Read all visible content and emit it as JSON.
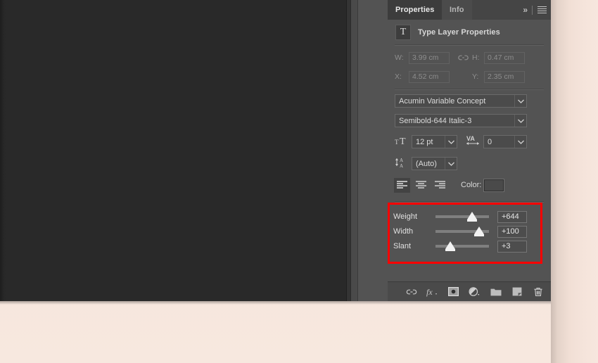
{
  "panel": {
    "tabs": [
      {
        "label": "Properties",
        "active": true
      },
      {
        "label": "Info",
        "active": false
      }
    ],
    "collapse_icon": "»",
    "menu_icon": "hamburger-menu-icon",
    "title": "Type Layer Properties",
    "title_icon_glyph": "T"
  },
  "geometry": {
    "w_label": "W:",
    "w_value": "3.99 cm",
    "h_label": "H:",
    "h_value": "0.47 cm",
    "x_label": "X:",
    "x_value": "4.52 cm",
    "y_label": "Y:",
    "y_value": "2.35 cm",
    "link_icon": "link-chain-icon"
  },
  "typography": {
    "font_family": "Acumin Variable Concept",
    "font_style": "Semibold-644 Italic-3",
    "font_size": "12 pt",
    "tracking": "0",
    "leading": "(Auto)",
    "color_label": "Color:",
    "color_value": "#4a4a4a",
    "alignment": [
      "left",
      "center",
      "right"
    ],
    "alignment_active": "left"
  },
  "variable_font": {
    "highlight_color": "#ff0000",
    "sliders": [
      {
        "name": "Weight",
        "value": "+644",
        "fraction": 0.66
      },
      {
        "name": "Width",
        "value": "+100",
        "fraction": 0.79
      },
      {
        "name": "Slant",
        "value": "+3",
        "fraction": 0.25
      }
    ]
  },
  "footer": {
    "icons": [
      "link-layers-icon",
      "fx-layer-style-icon",
      "add-layer-mask-icon",
      "new-fill-adjustment-layer-icon",
      "new-group-icon",
      "new-layer-icon",
      "delete-layer-icon"
    ]
  },
  "canvas": {
    "background_color": "#292929"
  }
}
